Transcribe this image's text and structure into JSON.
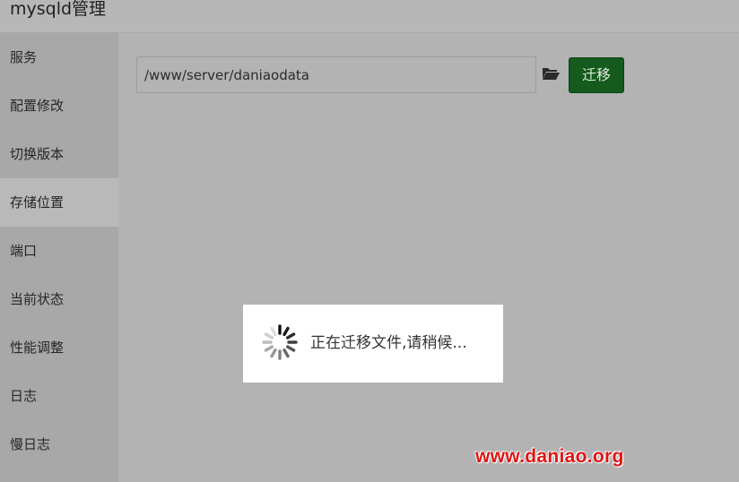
{
  "app": {
    "title": "mysqld管理"
  },
  "sidebar": {
    "items": [
      {
        "label": "服务"
      },
      {
        "label": "配置修改"
      },
      {
        "label": "切换版本"
      },
      {
        "label": "存储位置",
        "active": true
      },
      {
        "label": "端口"
      },
      {
        "label": "当前状态"
      },
      {
        "label": "性能调整"
      },
      {
        "label": "日志"
      },
      {
        "label": "慢日志"
      }
    ]
  },
  "storage": {
    "path_value": "/www/server/daniaodata",
    "folder_icon": "folder-open-icon",
    "migrate_label": "迁移",
    "migrate_color": "#145b1d"
  },
  "loading": {
    "text": "正在迁移文件,请稍候...",
    "spinner_icon": "spinner-icon"
  },
  "watermark": {
    "text": "www.daniao.org",
    "color": "#e01414"
  }
}
